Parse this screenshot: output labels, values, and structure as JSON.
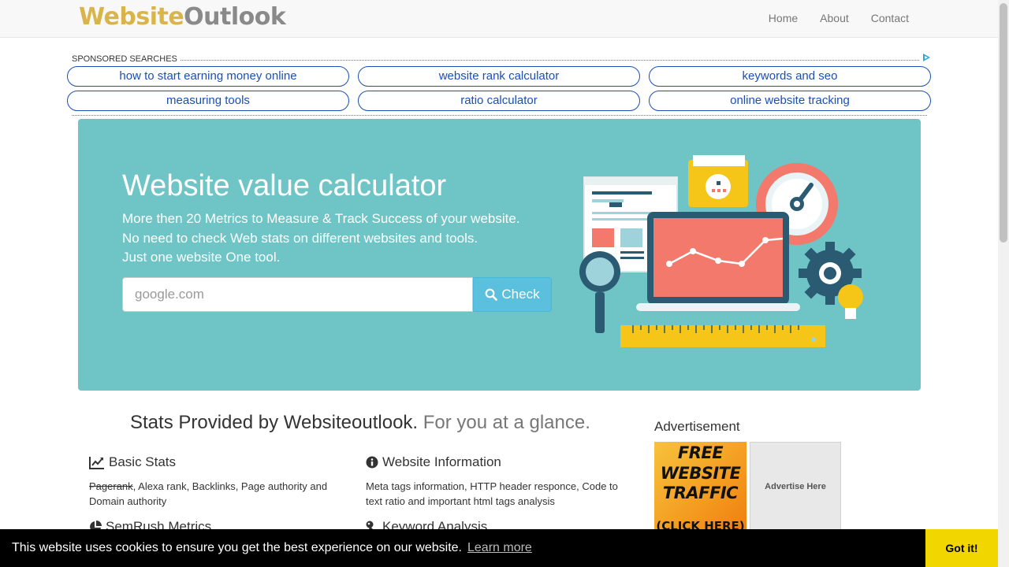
{
  "header": {
    "logo_part1": "Website",
    "logo_part2": "Outlook",
    "nav": [
      "Home",
      "About",
      "Contact"
    ]
  },
  "sponsored": {
    "label": "SPONSORED SEARCHES",
    "links": [
      "how to start earning money online",
      "website rank calculator",
      "keywords and seo",
      "measuring tools",
      "ratio calculator",
      "online website tracking"
    ]
  },
  "hero": {
    "title": "Website value calculator",
    "line1": "More then 20 Metrics to Measure & Track Success of your website.",
    "line2": "No need to check Web stats on different websites and tools.",
    "line3": "Just one website One tool.",
    "search_placeholder": "google.com",
    "check_label": "Check"
  },
  "stats": {
    "title_main": "Stats Provided by Websiteoutlook.",
    "title_muted": "For you at a glance.",
    "features": [
      {
        "icon": "line-chart-icon",
        "title": "Basic Stats",
        "struck": "Pagerank",
        "desc": ", Alexa rank, Backlinks, Page authority and Domain authority"
      },
      {
        "icon": "info-circle-icon",
        "title": "Website Information",
        "desc": "Meta tags information, HTTP header responce, Code to text ratio and important html tags analysis"
      },
      {
        "icon": "pie-chart-icon",
        "title": "SemRush Metrics"
      },
      {
        "icon": "key-icon",
        "title": "Keyword Analysis"
      }
    ]
  },
  "ads": {
    "title": "Advertisement",
    "banner_line1": "FREE",
    "banner_line2": "WEBSITE",
    "banner_line3": "TRAFFIC",
    "banner_click": "(CLICK HERE)",
    "placeholder": "Advertise Here"
  },
  "cookie": {
    "message": "This website uses cookies to ensure you get the best experience on our website.",
    "learn_more": "Learn more",
    "accept": "Got it!"
  },
  "colors": {
    "hero_bg": "#6fc4c6",
    "check_button": "#5bc0de",
    "logo_gold": "#d9b44a",
    "cookie_accept": "#f1d600",
    "sponsored_link": "#1a4fb5"
  }
}
